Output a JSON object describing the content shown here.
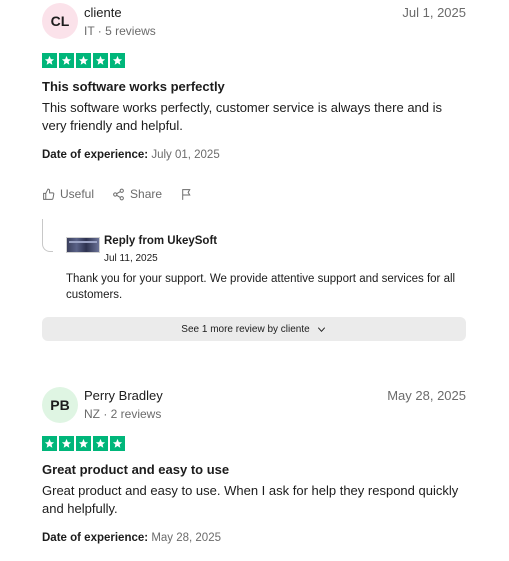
{
  "reviews": [
    {
      "initials": "CL",
      "avatar_color": "#fbe2ea",
      "name": "cliente",
      "meta": "IT · 5 reviews",
      "date": "Jul 1, 2025",
      "rating": 5,
      "title": "This software works perfectly",
      "body": "This software works perfectly, customer service is always there and is very friendly and helpful.",
      "experience_label": "Date of experience:",
      "experience_date": "July 01, 2025",
      "useful_label": "Useful",
      "share_label": "Share",
      "reply": {
        "from": "Reply from UkeySoft",
        "date": "Jul 11, 2025",
        "text": "Thank you for your support. We provide attentive support and services for all customers."
      },
      "see_more_label": "See 1 more review by cliente"
    },
    {
      "initials": "PB",
      "avatar_color": "#dff5e3",
      "name": "Perry Bradley",
      "meta": "NZ · 2 reviews",
      "date": "May 28, 2025",
      "rating": 5,
      "title": "Great product and easy to use",
      "body": "Great product and easy to use. When I ask for help they respond quickly and helpfully.",
      "experience_label": "Date of experience:",
      "experience_date": "May 28, 2025"
    }
  ],
  "colors": {
    "star_green": "#00b67a",
    "see_more_bg": "#ebebeb"
  }
}
